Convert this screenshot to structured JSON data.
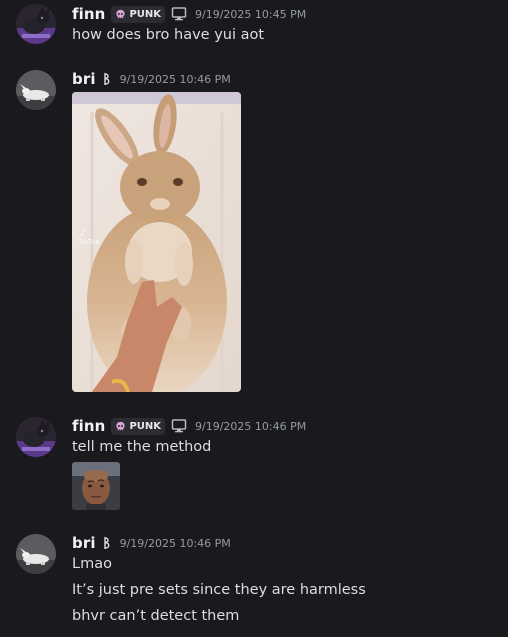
{
  "messages": [
    {
      "username": "finn",
      "tag_label": "PUNK",
      "timestamp": "9/19/2025 10:45 PM",
      "lines": [
        "how does bro have yui aot"
      ]
    },
    {
      "username": "bri",
      "timestamp": "9/19/2025 10:46 PM",
      "attachment": "rabbit-video-image",
      "watermark_text": "TikTok"
    },
    {
      "username": "finn",
      "tag_label": "PUNK",
      "timestamp": "9/19/2025 10:46 PM",
      "lines": [
        "tell me the method"
      ],
      "attachment": "reaction-image"
    },
    {
      "username": "bri",
      "timestamp": "9/19/2025 10:46 PM",
      "lines": [
        "Lmao",
        "It’s just pre sets since they are harmless",
        "bhvr can’t detect them"
      ]
    }
  ],
  "colors": {
    "background": "#1a1a1e",
    "username": "#f2f3f5",
    "timestamp": "#949ba4",
    "text": "#dbdee1",
    "tag_bg": "#2b2d31"
  },
  "icons": [
    "skull-icon",
    "monitor-icon",
    "beta-badge-icon"
  ]
}
